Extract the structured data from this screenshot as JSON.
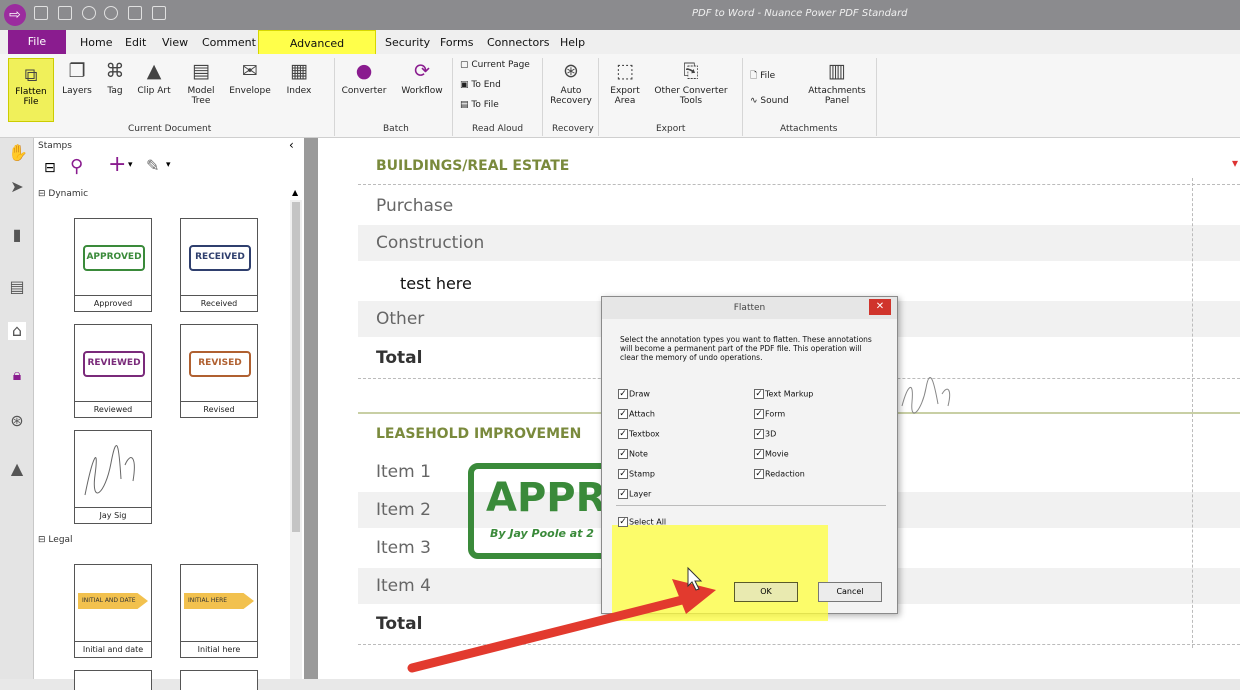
{
  "window": {
    "title": "PDF to Word - Nuance Power PDF Standard"
  },
  "menu": {
    "file": "File",
    "tabs": [
      "Home",
      "Edit",
      "View",
      "Comment"
    ],
    "active": "Advanced Processing",
    "tabs2": [
      "Security",
      "Forms",
      "Connectors",
      "Help"
    ]
  },
  "ribbon": {
    "flatten": "Flatten File",
    "layers": "Layers",
    "tag": "Tag",
    "clipart": "Clip Art",
    "modeltree": "Model Tree",
    "envelope": "Envelope",
    "index": "Index",
    "group_current_document": "Current Document",
    "converter": "Converter",
    "workflow": "Workflow",
    "group_batch": "Batch",
    "current_page": "Current Page",
    "to_end": "To End",
    "to_file": "To File",
    "group_read_aloud": "Read Aloud",
    "auto_recovery": "Auto Recovery",
    "group_recovery": "Recovery",
    "export_area": "Export Area",
    "other_converter": "Other Converter Tools",
    "group_export": "Export",
    "att_file": "File",
    "att_sound": "Sound",
    "att_panel": "Attachments Panel",
    "group_attachments": "Attachments"
  },
  "stamps": {
    "title": "Stamps",
    "dynamic": "Dynamic",
    "legal": "Legal",
    "cards": [
      {
        "label": "Approved",
        "text": "APPROVED",
        "color": "#3a8a3a"
      },
      {
        "label": "Received",
        "text": "RECEIVED",
        "color": "#2f3f6e"
      },
      {
        "label": "Reviewed",
        "text": "REVIEWED",
        "color": "#7a2a7a"
      },
      {
        "label": "Revised",
        "text": "REVISED",
        "color": "#b06030"
      }
    ],
    "sig_label": "Jay Sig",
    "legal_cards": [
      {
        "label": "Initial and date",
        "text": "INITIAL AND DATE"
      },
      {
        "label": "Initial here",
        "text": "INITIAL HERE"
      }
    ]
  },
  "document": {
    "section1": "BUILDINGS/REAL ESTATE",
    "rows1": [
      "Purchase",
      "Construction",
      "test here",
      "Other",
      "Total"
    ],
    "section2": "LEASEHOLD IMPROVEMEN",
    "rows2": [
      "Item 1",
      "Item 2",
      "Item 3",
      "Item 4",
      "Total"
    ],
    "stamp_big": "APPRO",
    "stamp_sub": "By Jay Poole at 2"
  },
  "dialog": {
    "title": "Flatten",
    "message": "Select the annotation types you want to flatten. These annotations will become a permanent part of the PDF file. This operation will clear the memory of undo operations.",
    "left": [
      "Draw",
      "Attach",
      "Textbox",
      "Note",
      "Stamp",
      "Layer"
    ],
    "right": [
      "Text Markup",
      "Form",
      "3D",
      "Movie",
      "Redaction"
    ],
    "select_all": "Select All",
    "ok": "OK",
    "cancel": "Cancel"
  },
  "colors": {
    "accent": "#8a1c8f",
    "highlight": "#ffff4a",
    "arrow": "#e23a2e",
    "section": "#7a8a3c"
  }
}
